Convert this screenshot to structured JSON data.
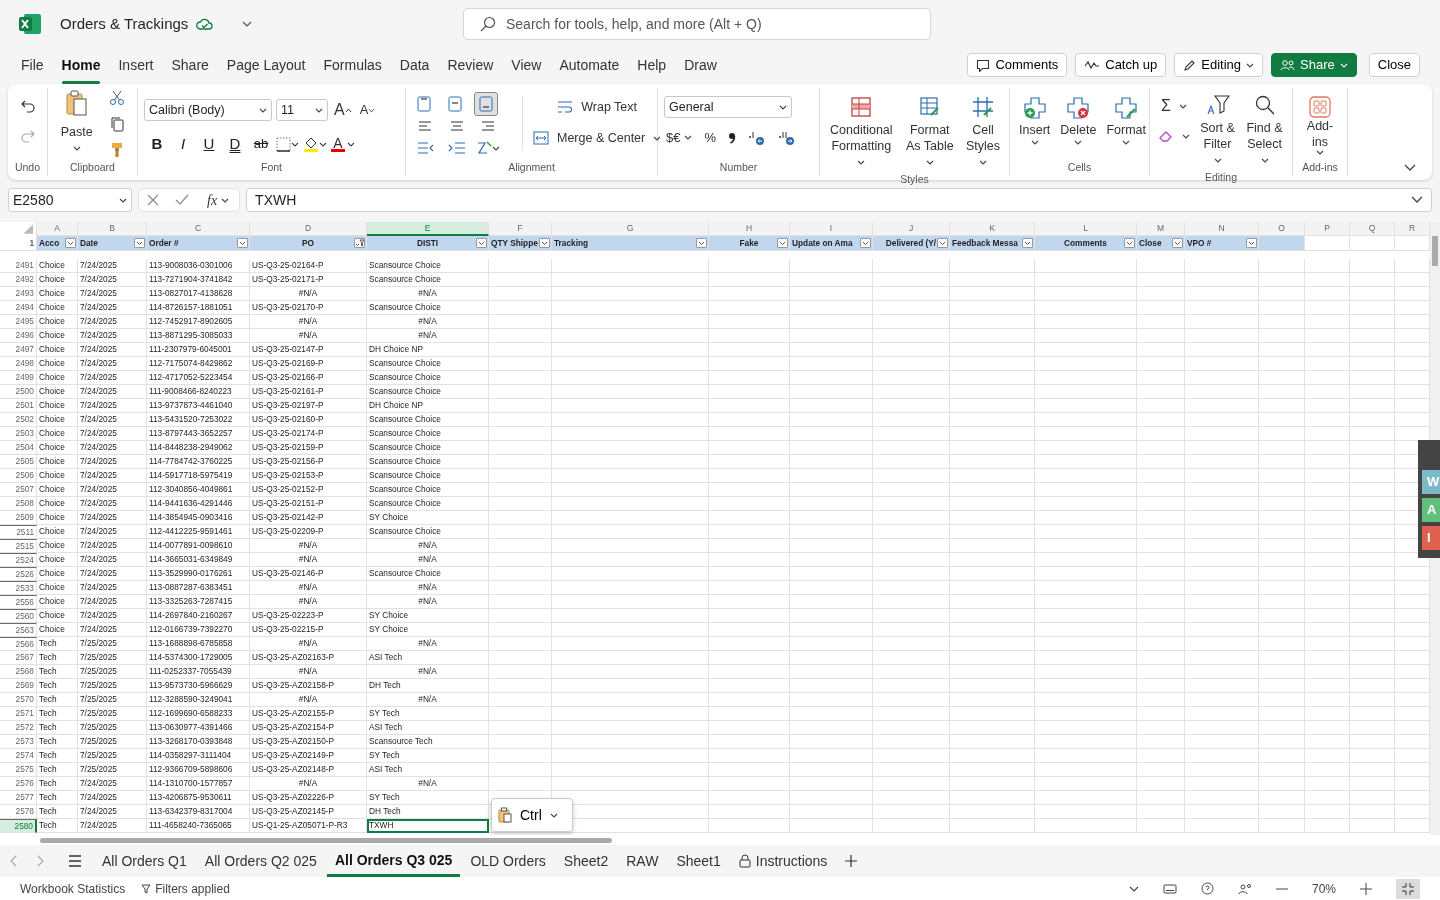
{
  "title_bar": {
    "file_name": "Orders & Trackings",
    "search_placeholder": "Search for tools, help, and more (Alt + Q)"
  },
  "menu": [
    {
      "label": "File",
      "selected": false
    },
    {
      "label": "Home",
      "selected": true
    },
    {
      "label": "Insert",
      "selected": false
    },
    {
      "label": "Share",
      "selected": false
    },
    {
      "label": "Page Layout",
      "selected": false
    },
    {
      "label": "Formulas",
      "selected": false
    },
    {
      "label": "Data",
      "selected": false
    },
    {
      "label": "Review",
      "selected": false
    },
    {
      "label": "View",
      "selected": false
    },
    {
      "label": "Automate",
      "selected": false
    },
    {
      "label": "Help",
      "selected": false
    },
    {
      "label": "Draw",
      "selected": false
    }
  ],
  "actions": [
    {
      "label": "Comments",
      "kind": "comments"
    },
    {
      "label": "Catch up",
      "kind": "catchup"
    },
    {
      "label": "Editing",
      "kind": "editing"
    },
    {
      "label": "Share",
      "kind": "share"
    },
    {
      "label": "Close",
      "kind": "close"
    }
  ],
  "ribbon": {
    "groups": [
      {
        "kind": "undo",
        "label": "Undo"
      },
      {
        "kind": "clipboard",
        "label": "Clipboard",
        "paste": "Paste"
      },
      {
        "kind": "font",
        "label": "Font",
        "font_name": "Calibri (Body)",
        "font_size": "11",
        "grow": "A",
        "shrink": "A",
        "styles": [
          "B",
          "I",
          "U",
          "D",
          "ab"
        ],
        "font_color": "A"
      },
      {
        "kind": "alignment",
        "label": "Alignment",
        "vertical_align": [
          {
            "selected": false
          },
          {
            "selected": false
          },
          {
            "selected": true
          }
        ],
        "wrap": "Wrap Text",
        "merge": "Merge & Center"
      },
      {
        "kind": "number",
        "label": "Number",
        "format": "General",
        "currency": "$€",
        "percent": "%"
      },
      {
        "kind": "styles",
        "label": "Styles",
        "buttons": [
          "Conditional Formatting",
          "Format As Table",
          "Cell Styles"
        ]
      },
      {
        "kind": "cells",
        "label": "Cells",
        "buttons": [
          "Insert",
          "Delete",
          "Format"
        ]
      },
      {
        "kind": "editing",
        "label": "Editing",
        "sum": "Σ",
        "buttons": [
          "Sort & Filter",
          "Find & Select"
        ]
      },
      {
        "kind": "addins",
        "label": "Add-ins",
        "buttons": [
          "Add-ins"
        ]
      }
    ]
  },
  "formula_bar": {
    "name_box": "E2580",
    "function_label": "fx",
    "formula": "TXWH"
  },
  "sheet": {
    "columns": [
      {
        "letter": "A",
        "header": "Acco",
        "centered": false,
        "table": true,
        "filter": true,
        "filtered": false,
        "selected": false
      },
      {
        "letter": "B",
        "header": "Date",
        "centered": false,
        "table": true,
        "filter": true,
        "filtered": false,
        "selected": false
      },
      {
        "letter": "C",
        "header": "Order #",
        "centered": false,
        "table": true,
        "filter": true,
        "filtered": false,
        "selected": false
      },
      {
        "letter": "D",
        "header": "PO",
        "centered": true,
        "table": true,
        "filter": true,
        "filtered": true,
        "selected": false
      },
      {
        "letter": "E",
        "header": "DISTI",
        "centered": true,
        "table": true,
        "filter": true,
        "filtered": false,
        "selected": true
      },
      {
        "letter": "F",
        "header": "QTY Shippe",
        "centered": false,
        "table": true,
        "filter": true,
        "filtered": false,
        "selected": false
      },
      {
        "letter": "G",
        "header": "Tracking",
        "centered": false,
        "table": true,
        "filter": true,
        "filtered": false,
        "selected": false
      },
      {
        "letter": "H",
        "header": "Fake",
        "centered": true,
        "table": true,
        "filter": true,
        "filtered": false,
        "selected": false
      },
      {
        "letter": "I",
        "header": "Update on Ama",
        "centered": false,
        "table": true,
        "filter": true,
        "filtered": false,
        "selected": false
      },
      {
        "letter": "J",
        "header": "Delivered (Y/",
        "centered": true,
        "table": true,
        "filter": true,
        "filtered": false,
        "selected": false
      },
      {
        "letter": "K",
        "header": "Feedback Messa",
        "centered": false,
        "table": true,
        "filter": true,
        "filtered": false,
        "selected": false
      },
      {
        "letter": "L",
        "header": "Comments",
        "centered": true,
        "table": true,
        "filter": true,
        "filtered": false,
        "selected": false
      },
      {
        "letter": "M",
        "header": "Close",
        "centered": false,
        "table": true,
        "filter": true,
        "filtered": false,
        "selected": false
      },
      {
        "letter": "N",
        "header": "VPO #",
        "centered": false,
        "table": true,
        "filter": true,
        "filtered": false,
        "selected": false
      },
      {
        "letter": "O",
        "table": true,
        "filter": false,
        "selected": false
      },
      {
        "letter": "P",
        "table": false,
        "filter": false,
        "selected": false
      },
      {
        "letter": "Q",
        "table": false,
        "filter": false,
        "selected": false
      },
      {
        "letter": "R",
        "table": false,
        "filter": false,
        "selected": false
      }
    ],
    "header_row": "1",
    "rows": [
      {
        "n": "2491",
        "account": "Choice",
        "date": "7/24/2025",
        "order": "113-9008036-0301006",
        "po": "US-Q3-25-02164-P",
        "disti": "Scansource Choice",
        "error": false,
        "hidden_before": false,
        "selected": false
      },
      {
        "n": "2492",
        "account": "Choice",
        "date": "7/24/2025",
        "order": "113-7271904-3741842",
        "po": "US-Q3-25-02171-P",
        "disti": "Scansource Choice",
        "error": false,
        "hidden_before": false,
        "selected": false
      },
      {
        "n": "2493",
        "account": "Choice",
        "date": "7/24/2025",
        "order": "113-0827017-4138628",
        "po": "#N/A",
        "disti": "#N/A",
        "error": true,
        "hidden_before": false,
        "selected": false
      },
      {
        "n": "2494",
        "account": "Choice",
        "date": "7/24/2025",
        "order": "114-8726157-1881051",
        "po": "US-Q3-25-02170-P",
        "disti": "Scansource Choice",
        "error": false,
        "hidden_before": false,
        "selected": false
      },
      {
        "n": "2495",
        "account": "Choice",
        "date": "7/24/2025",
        "order": "112-7452917-8902605",
        "po": "#N/A",
        "disti": "#N/A",
        "error": true,
        "hidden_before": false,
        "selected": false
      },
      {
        "n": "2496",
        "account": "Choice",
        "date": "7/24/2025",
        "order": "113-8871295-3085033",
        "po": "#N/A",
        "disti": "#N/A",
        "error": true,
        "hidden_before": false,
        "selected": false
      },
      {
        "n": "2497",
        "account": "Choice",
        "date": "7/24/2025",
        "order": "111-2307979-6045001",
        "po": "US-Q3-25-02147-P",
        "disti": "DH Choice NP",
        "error": false,
        "hidden_before": false,
        "selected": false
      },
      {
        "n": "2498",
        "account": "Choice",
        "date": "7/24/2025",
        "order": "112-7175074-8429862",
        "po": "US-Q3-25-02169-P",
        "disti": "Scansource Choice",
        "error": false,
        "hidden_before": false,
        "selected": false
      },
      {
        "n": "2499",
        "account": "Choice",
        "date": "7/24/2025",
        "order": "112-4717052-5223454",
        "po": "US-Q3-25-02166-P",
        "disti": "Scansource Choice",
        "error": false,
        "hidden_before": false,
        "selected": false
      },
      {
        "n": "2500",
        "account": "Choice",
        "date": "7/24/2025",
        "order": "111-9008466-8240223",
        "po": "US-Q3-25-02161-P",
        "disti": "Scansource Choice",
        "error": false,
        "hidden_before": false,
        "selected": false
      },
      {
        "n": "2501",
        "account": "Choice",
        "date": "7/24/2025",
        "order": "113-9737873-4461040",
        "po": "US-Q3-25-02197-P",
        "disti": "DH Choice NP",
        "error": false,
        "hidden_before": false,
        "selected": false
      },
      {
        "n": "2502",
        "account": "Choice",
        "date": "7/24/2025",
        "order": "113-5431520-7253022",
        "po": "US-Q3-25-02160-P",
        "disti": "Scansource Choice",
        "error": false,
        "hidden_before": false,
        "selected": false
      },
      {
        "n": "2503",
        "account": "Choice",
        "date": "7/24/2025",
        "order": "113-8797443-3652257",
        "po": "US-Q3-25-02174-P",
        "disti": "Scansource Choice",
        "error": false,
        "hidden_before": false,
        "selected": false
      },
      {
        "n": "2504",
        "account": "Choice",
        "date": "7/24/2025",
        "order": "114-8448238-2949062",
        "po": "US-Q3-25-02159-P",
        "disti": "Scansource Choice",
        "error": false,
        "hidden_before": false,
        "selected": false
      },
      {
        "n": "2505",
        "account": "Choice",
        "date": "7/24/2025",
        "order": "114-7784742-3760225",
        "po": "US-Q3-25-02156-P",
        "disti": "Scansource Choice",
        "error": false,
        "hidden_before": false,
        "selected": false
      },
      {
        "n": "2506",
        "account": "Choice",
        "date": "7/24/2025",
        "order": "114-5917718-5975419",
        "po": "US-Q3-25-02153-P",
        "disti": "Scansource Choice",
        "error": false,
        "hidden_before": false,
        "selected": false
      },
      {
        "n": "2507",
        "account": "Choice",
        "date": "7/24/2025",
        "order": "112-3040856-4049861",
        "po": "US-Q3-25-02152-P",
        "disti": "Scansource Choice",
        "error": false,
        "hidden_before": false,
        "selected": false
      },
      {
        "n": "2508",
        "account": "Choice",
        "date": "7/24/2025",
        "order": "114-9441636-4291446",
        "po": "US-Q3-25-02151-P",
        "disti": "Scansource Choice",
        "error": false,
        "hidden_before": false,
        "selected": false
      },
      {
        "n": "2509",
        "account": "Choice",
        "date": "7/24/2025",
        "order": "114-3854945-0903416",
        "po": "US-Q3-25-02142-P",
        "disti": "SY Choice",
        "error": false,
        "hidden_before": false,
        "selected": false
      },
      {
        "n": "2511",
        "account": "Choice",
        "date": "7/24/2025",
        "order": "112-4412225-9591461",
        "po": "US-Q3-25-02209-P",
        "disti": "Scansource Choice",
        "error": false,
        "hidden_before": true,
        "selected": false
      },
      {
        "n": "2515",
        "account": "Choice",
        "date": "7/24/2025",
        "order": "114-0077891-0098610",
        "po": "#N/A",
        "disti": "#N/A",
        "error": true,
        "hidden_before": true,
        "selected": false
      },
      {
        "n": "2524",
        "account": "Choice",
        "date": "7/24/2025",
        "order": "114-3665031-6349849",
        "po": "#N/A",
        "disti": "#N/A",
        "error": true,
        "hidden_before": true,
        "selected": false
      },
      {
        "n": "2526",
        "account": "Choice",
        "date": "7/24/2025",
        "order": "113-3529990-0176261",
        "po": "US-Q3-25-02146-P",
        "disti": "Scansource Choice",
        "error": false,
        "hidden_before": true,
        "selected": false
      },
      {
        "n": "2533",
        "account": "Choice",
        "date": "7/24/2025",
        "order": "113-0887287-6383451",
        "po": "#N/A",
        "disti": "#N/A",
        "error": true,
        "hidden_before": true,
        "selected": false
      },
      {
        "n": "2556",
        "account": "Choice",
        "date": "7/24/2025",
        "order": "113-3325263-7287415",
        "po": "#N/A",
        "disti": "#N/A",
        "error": true,
        "hidden_before": true,
        "selected": false
      },
      {
        "n": "2560",
        "account": "Choice",
        "date": "7/24/2025",
        "order": "114-2697840-2160267",
        "po": "US-Q3-25-02223-P",
        "disti": "SY Choice",
        "error": false,
        "hidden_before": true,
        "selected": false
      },
      {
        "n": "2563",
        "account": "Choice",
        "date": "7/24/2025",
        "order": "112-0166739-7392270",
        "po": "US-Q3-25-02215-P",
        "disti": "SY Choice",
        "error": false,
        "hidden_before": true,
        "selected": false
      },
      {
        "n": "2566",
        "account": "Tech",
        "date": "7/25/2025",
        "order": "113-1688898-6785858",
        "po": "#N/A",
        "disti": "#N/A",
        "error": true,
        "hidden_before": true,
        "selected": false
      },
      {
        "n": "2567",
        "account": "Tech",
        "date": "7/25/2025",
        "order": "114-5374300-1729005",
        "po": "US-Q3-25-AZ02163-P",
        "disti": "ASI Tech",
        "error": false,
        "hidden_before": false,
        "selected": false
      },
      {
        "n": "2568",
        "account": "Tech",
        "date": "7/25/2025",
        "order": "111-0252337-7055439",
        "po": "#N/A",
        "disti": "#N/A",
        "error": true,
        "hidden_before": false,
        "selected": false
      },
      {
        "n": "2569",
        "account": "Tech",
        "date": "7/25/2025",
        "order": "113-9573730-5966629",
        "po": "US-Q3-25-AZ02158-P",
        "disti": "DH Tech",
        "error": false,
        "hidden_before": false,
        "selected": false
      },
      {
        "n": "2570",
        "account": "Tech",
        "date": "7/25/2025",
        "order": "112-3288590-3249041",
        "po": "#N/A",
        "disti": "#N/A",
        "error": true,
        "hidden_before": false,
        "selected": false
      },
      {
        "n": "2571",
        "account": "Tech",
        "date": "7/25/2025",
        "order": "112-1699690-6588233",
        "po": "US-Q3-25-AZ02155-P",
        "disti": "SY Tech",
        "error": false,
        "hidden_before": false,
        "selected": false
      },
      {
        "n": "2572",
        "account": "Tech",
        "date": "7/25/2025",
        "order": "113-0630977-4391466",
        "po": "US-Q3-25-AZ02154-P",
        "disti": "ASI Tech",
        "error": false,
        "hidden_before": false,
        "selected": false
      },
      {
        "n": "2573",
        "account": "Tech",
        "date": "7/25/2025",
        "order": "113-3268170-0393848",
        "po": "US-Q3-25-AZ02150-P",
        "disti": "Scansource Tech",
        "error": false,
        "hidden_before": false,
        "selected": false
      },
      {
        "n": "2574",
        "account": "Tech",
        "date": "7/25/2025",
        "order": "114-0358297-3111404",
        "po": "US-Q3-25-AZ02149-P",
        "disti": "SY Tech",
        "error": false,
        "hidden_before": false,
        "selected": false
      },
      {
        "n": "2575",
        "account": "Tech",
        "date": "7/25/2025",
        "order": "112-9366709-5898606",
        "po": "US-Q3-25-AZ02148-P",
        "disti": "ASI Tech",
        "error": false,
        "hidden_before": false,
        "selected": false
      },
      {
        "n": "2576",
        "account": "Tech",
        "date": "7/24/2025",
        "order": "114-1310700-1577857",
        "po": "#N/A",
        "disti": "#N/A",
        "error": true,
        "hidden_before": false,
        "selected": false
      },
      {
        "n": "2577",
        "account": "Tech",
        "date": "7/24/2025",
        "order": "113-4206875-9530611",
        "po": "US-Q3-25-AZ02226-P",
        "disti": "SY Tech",
        "error": false,
        "hidden_before": false,
        "selected": false
      },
      {
        "n": "2578",
        "account": "Tech",
        "date": "7/24/2025",
        "order": "113-6342379-8317004",
        "po": "US-Q3-25-AZ02145-P",
        "disti": "DH Tech",
        "error": false,
        "hidden_before": false,
        "selected": false
      },
      {
        "n": "2580",
        "account": "Tech",
        "date": "7/24/2025",
        "order": "111-4658240-7365065",
        "po": "US-Q1-25-AZ05071-P-R3",
        "disti": "TXWH",
        "error": false,
        "hidden_before": true,
        "selected": true
      }
    ]
  },
  "paste_options": {
    "label": "Ctrl"
  },
  "side_panel": {
    "items": [
      {
        "label": "W",
        "color": "#7db9c9"
      },
      {
        "label": "A",
        "color": "#5fbf7d"
      },
      {
        "label": "I",
        "color": "#e0604f"
      }
    ]
  },
  "sheet_tabs": [
    {
      "label": "All Orders Q1",
      "locked": false,
      "selected": false
    },
    {
      "label": "All Orders Q2 025",
      "locked": false,
      "selected": false
    },
    {
      "label": "All Orders Q3 025",
      "locked": false,
      "selected": true
    },
    {
      "label": "OLD Orders",
      "locked": false,
      "selected": false
    },
    {
      "label": "Sheet2",
      "locked": false,
      "selected": false
    },
    {
      "label": "RAW",
      "locked": false,
      "selected": false
    },
    {
      "label": "Sheet1",
      "locked": false,
      "selected": false
    },
    {
      "label": "Instructions",
      "locked": true,
      "selected": false
    }
  ],
  "status_bar": {
    "statistics": "Workbook Statistics",
    "filters": "Filters applied",
    "zoom": "70%"
  }
}
